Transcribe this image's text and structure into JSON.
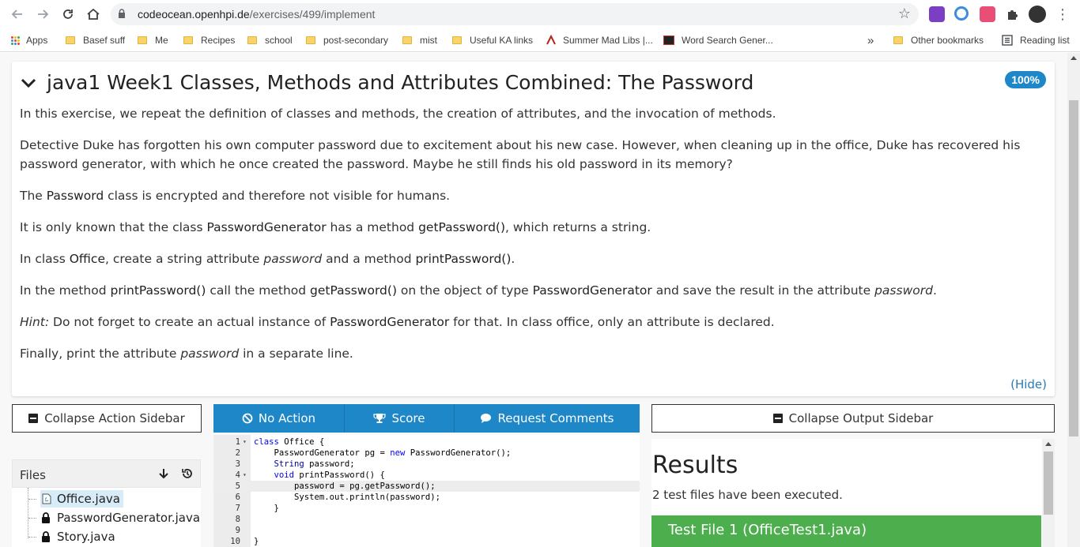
{
  "browser": {
    "url_host": "codeocean.openhpi.de",
    "url_path": "/exercises/499/implement",
    "bookmarks": [
      "Apps",
      "Basef suff",
      "Me",
      "Recipes",
      "school",
      "post-secondary",
      "mist",
      "Useful KA links",
      "Summer Mad Libs |...",
      "Word Search Gener...",
      "Other bookmarks",
      "Reading list"
    ],
    "overflow": "»"
  },
  "exercise": {
    "title": "java1 Week1 Classes, Methods and Attributes Combined: The Password",
    "progress_badge": "100%",
    "p1": "In this exercise, we repeat the definition of classes and methods, the creation of attributes, and the invocation of methods.",
    "p2": "Detective Duke has forgotten his own computer password due to excitement about his new case. However, when cleaning up in the office, Duke has recovered his password generator, with which he once created the password. Maybe he still finds his old password in its memory?",
    "p3a": "The ",
    "p3b": "Password",
    "p3c": " class is encrypted and therefore not visible for humans.",
    "p4a": "It is only known that the class ",
    "p4b": "PasswordGenerator",
    "p4c": " has a method ",
    "p4d": "getPassword()",
    "p4e": ", which returns a string.",
    "p5a": "In class ",
    "p5b": "Office",
    "p5c": ", create a string attribute ",
    "p5d": "password",
    "p5e": " and a method ",
    "p5f": "printPassword()",
    "p5g": ".",
    "p6a": "In the method ",
    "p6b": "printPassword()",
    "p6c": " call the method ",
    "p6d": "getPassword()",
    "p6e": " on the object of type ",
    "p6f": "PasswordGenerator",
    "p6g": " and save the result in the attribute ",
    "p6h": "password",
    "p6i": ".",
    "p7a": "Hint:",
    "p7b": " Do not forget to create an actual instance of ",
    "p7c": "PasswordGenerator",
    "p7d": " for that. In class office, only an attribute is declared.",
    "p8a": "Finally, print the attribute ",
    "p8b": "password",
    "p8c": " in a separate line.",
    "hide_link": "(Hide)"
  },
  "actions": {
    "collapse_action_sidebar": "Collapse Action Sidebar",
    "no_action": "No Action",
    "score": "Score",
    "request_comments": "Request Comments",
    "collapse_output_sidebar": "Collapse Output Sidebar"
  },
  "files": {
    "header": "Files",
    "items": [
      {
        "name": "Office.java",
        "icon": "java-file-icon",
        "selected": true
      },
      {
        "name": "PasswordGenerator.java",
        "icon": "lock-icon",
        "selected": false
      },
      {
        "name": "Story.java",
        "icon": "lock-icon",
        "selected": false
      }
    ]
  },
  "editor": {
    "lines": [
      {
        "n": "1",
        "fold": "▾",
        "code": "class Office {"
      },
      {
        "n": "2",
        "fold": "",
        "code": "    PasswordGenerator pg = new PasswordGenerator();"
      },
      {
        "n": "3",
        "fold": "",
        "code": "    String password;"
      },
      {
        "n": "4",
        "fold": "▾",
        "code": "    void printPassword() {"
      },
      {
        "n": "5",
        "fold": "",
        "code": "        password = pg.getPassword();"
      },
      {
        "n": "6",
        "fold": "",
        "code": "        System.out.println(password);"
      },
      {
        "n": "7",
        "fold": "",
        "code": "    }"
      },
      {
        "n": "8",
        "fold": "",
        "code": ""
      },
      {
        "n": "9",
        "fold": "",
        "code": ""
      },
      {
        "n": "10",
        "fold": "",
        "code": "}"
      }
    ],
    "active_line": "5"
  },
  "output": {
    "title": "Results",
    "summary": "2 test files have been executed.",
    "test_file_1": "Test File 1 (OfficeTest1.java)"
  },
  "colors": {
    "primary": "#1e87c8",
    "success": "#4cae4c"
  }
}
